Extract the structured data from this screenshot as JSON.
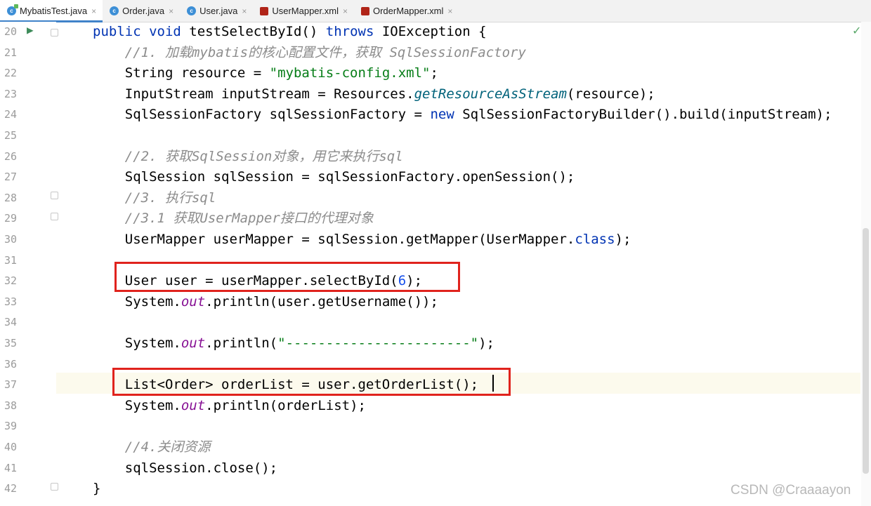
{
  "tabs": [
    {
      "label": "MybatisTest.java",
      "icon": "java-test-class-icon",
      "active": true
    },
    {
      "label": "Order.java",
      "icon": "java-class-icon",
      "active": false
    },
    {
      "label": "User.java",
      "icon": "java-class-icon",
      "active": false
    },
    {
      "label": "UserMapper.xml",
      "icon": "mybatis-xml-icon",
      "active": false
    },
    {
      "label": "OrderMapper.xml",
      "icon": "mybatis-xml-icon",
      "active": false
    }
  ],
  "tab_close_glyph": "×",
  "gutter": {
    "run_icon": "run-test-icon"
  },
  "status": {
    "inspection": "check-icon",
    "check_glyph": "✓"
  },
  "lines": [
    {
      "n": "20",
      "tokens": [
        {
          "t": "public ",
          "c": "kw"
        },
        {
          "t": "void ",
          "c": "kw"
        },
        {
          "t": "testSelectById() "
        },
        {
          "t": "throws ",
          "c": "kw"
        },
        {
          "t": "IOException {"
        }
      ]
    },
    {
      "n": "21",
      "tokens": [
        {
          "t": "    //1. 加载mybatis的核心配置文件，获取 SqlSessionFactory",
          "c": "cm"
        }
      ]
    },
    {
      "n": "22",
      "tokens": [
        {
          "t": "    String resource = "
        },
        {
          "t": "\"mybatis-config.xml\"",
          "c": "str"
        },
        {
          "t": ";"
        }
      ]
    },
    {
      "n": "23",
      "tokens": [
        {
          "t": "    InputStream inputStream = Resources."
        },
        {
          "t": "getResourceAsStream",
          "c": "mi"
        },
        {
          "t": "(resource);"
        }
      ]
    },
    {
      "n": "24",
      "tokens": [
        {
          "t": "    SqlSessionFactory sqlSessionFactory = "
        },
        {
          "t": "new ",
          "c": "kw"
        },
        {
          "t": "SqlSessionFactoryBuilder().build(inputStream);"
        }
      ]
    },
    {
      "n": "25",
      "tokens": []
    },
    {
      "n": "26",
      "tokens": [
        {
          "t": "    //2. 获取SqlSession对象，用它来执行sql",
          "c": "cm"
        }
      ]
    },
    {
      "n": "27",
      "tokens": [
        {
          "t": "    SqlSession sqlSession = sqlSessionFactory.openSession();"
        }
      ]
    },
    {
      "n": "28",
      "tokens": [
        {
          "t": "    //3. 执行sql",
          "c": "cm"
        }
      ]
    },
    {
      "n": "29",
      "tokens": [
        {
          "t": "    //3.1 获取UserMapper接口的代理对象",
          "c": "cm"
        }
      ]
    },
    {
      "n": "30",
      "tokens": [
        {
          "t": "    UserMapper userMapper = sqlSession.getMapper(UserMapper."
        },
        {
          "t": "class",
          "c": "kw"
        },
        {
          "t": ");"
        }
      ]
    },
    {
      "n": "31",
      "tokens": []
    },
    {
      "n": "32",
      "tokens": [
        {
          "t": "    User user = userMapper.selectById("
        },
        {
          "t": "6",
          "c": "num"
        },
        {
          "t": ");"
        }
      ]
    },
    {
      "n": "33",
      "tokens": [
        {
          "t": "    System."
        },
        {
          "t": "out",
          "c": "st"
        },
        {
          "t": ".println(user.getUsername());"
        }
      ]
    },
    {
      "n": "34",
      "tokens": []
    },
    {
      "n": "35",
      "tokens": [
        {
          "t": "    System."
        },
        {
          "t": "out",
          "c": "st"
        },
        {
          "t": ".println("
        },
        {
          "t": "\"-----------------------\"",
          "c": "str"
        },
        {
          "t": ");"
        }
      ]
    },
    {
      "n": "36",
      "tokens": []
    },
    {
      "n": "37",
      "tokens": [
        {
          "t": "    List<Order> orderList = user.getOrderList();"
        }
      ]
    },
    {
      "n": "38",
      "tokens": [
        {
          "t": "    System."
        },
        {
          "t": "out",
          "c": "st"
        },
        {
          "t": ".println(orderList);"
        }
      ]
    },
    {
      "n": "39",
      "tokens": []
    },
    {
      "n": "40",
      "tokens": [
        {
          "t": "    //4.关闭资源",
          "c": "cm"
        }
      ]
    },
    {
      "n": "41",
      "tokens": [
        {
          "t": "    sqlSession.close();"
        }
      ]
    },
    {
      "n": "42",
      "tokens": [
        {
          "t": "}"
        }
      ]
    }
  ],
  "watermark": "CSDN @Craaaayon",
  "colors": {
    "highlight_box": "#e0231d",
    "keyword": "#0033b3",
    "string": "#067d17",
    "comment": "#8c8c8c",
    "static_field": "#871094"
  }
}
